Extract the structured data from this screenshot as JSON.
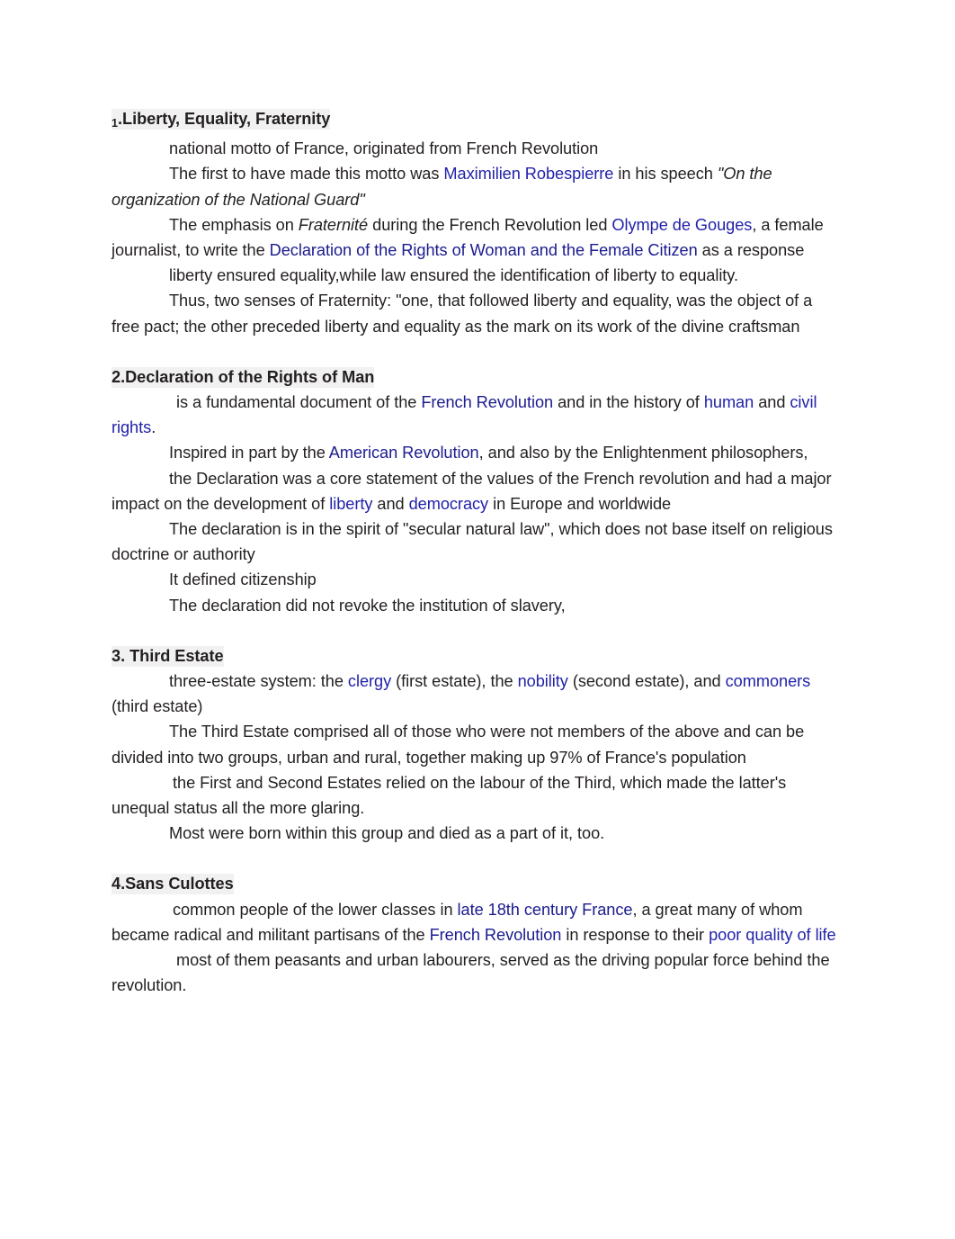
{
  "document": {
    "title": "French Revolution Study Notes",
    "text_color": "#231f20",
    "link_color": "#2222aa",
    "link_color_dark": "#1b1b8f",
    "heading_highlight": "#f1f1f1",
    "page_background": "#ffffff"
  },
  "sections": [
    {
      "number": "1",
      "number_style": "subscript",
      "heading_rest": ".Liberty, Equality, Fraternity",
      "paragraphs": [
        {
          "runs": [
            {
              "t": "national motto of France, originated from French Revolution",
              "s": "plain"
            }
          ]
        },
        {
          "runs": [
            {
              "t": "The first to have made this motto was ",
              "s": "plain"
            },
            {
              "t": "Maximilien Robespierre",
              "s": "link"
            },
            {
              "t": " in his speech ",
              "s": "plain"
            },
            {
              "t": "\"On the organization of the National Guard\"",
              "s": "italic"
            }
          ]
        },
        {
          "runs": [
            {
              "t": "The emphasis on ",
              "s": "plain"
            },
            {
              "t": "Fraternité",
              "s": "italic"
            },
            {
              "t": " during the French Revolution led ",
              "s": "plain"
            },
            {
              "t": "Olympe de Gouges",
              "s": "link"
            },
            {
              "t": ", a female journalist, to write the ",
              "s": "plain"
            },
            {
              "t": "Declaration of the Rights of Woman and the Female Citizen",
              "s": "link-dark"
            },
            {
              "t": " as a response",
              "s": "plain"
            }
          ]
        },
        {
          "runs": [
            {
              "t": "liberty ensured equality,while law ensured the identification of liberty to equality.",
              "s": "plain"
            }
          ]
        },
        {
          "runs": [
            {
              "t": "Thus, two senses of Fraternity: \"one, that followed liberty and equality, was the object of a free pact; the other preceded liberty and equality as the mark on its work of the divine craftsman",
              "s": "plain"
            }
          ]
        }
      ]
    },
    {
      "number": "2",
      "number_style": "normal",
      "heading_rest": "2.Declaration of the Rights of Man",
      "paragraphs": [
        {
          "runs": [
            {
              "t": " is a fundamental document of the ",
              "s": "plain"
            },
            {
              "t": "French Revolution",
              "s": "link-dark"
            },
            {
              "t": " and in the history of ",
              "s": "plain"
            },
            {
              "t": "human",
              "s": "link"
            },
            {
              "t": " and ",
              "s": "plain"
            },
            {
              "t": "civil rights",
              "s": "link"
            },
            {
              "t": ".",
              "s": "plain"
            }
          ]
        },
        {
          "runs": [
            {
              "t": "Inspired in part by the ",
              "s": "plain"
            },
            {
              "t": "American Revolution",
              "s": "link-dark"
            },
            {
              "t": ", and also by the Enlightenment philosophers,",
              "s": "plain"
            }
          ]
        },
        {
          "runs": [
            {
              "t": "the Declaration was a core statement of the values of the French revolution and had a major impact on the development of ",
              "s": "plain"
            },
            {
              "t": "liberty",
              "s": "link"
            },
            {
              "t": " and ",
              "s": "plain"
            },
            {
              "t": "democracy",
              "s": "link"
            },
            {
              "t": " in Europe and worldwide",
              "s": "plain"
            }
          ]
        },
        {
          "runs": [
            {
              "t": "The declaration is in the spirit of \"secular natural law\", which does not base itself on religious doctrine or authority",
              "s": "plain"
            }
          ]
        },
        {
          "runs": [
            {
              "t": "It defined citizenship",
              "s": "plain"
            }
          ]
        },
        {
          "runs": [
            {
              "t": "The declaration did not revoke the institution of slavery,",
              "s": "plain"
            }
          ]
        }
      ]
    },
    {
      "number": "3",
      "number_style": "normal",
      "heading_rest": "3. Third Estate",
      "paragraphs": [
        {
          "runs": [
            {
              "t": "three-estate system: the ",
              "s": "plain"
            },
            {
              "t": "clergy",
              "s": "link"
            },
            {
              "t": " (first estate), the ",
              "s": "plain"
            },
            {
              "t": "nobility",
              "s": "link"
            },
            {
              "t": " (second estate), and ",
              "s": "plain"
            },
            {
              "t": "commoners",
              "s": "link"
            },
            {
              "t": " (third estate)",
              "s": "plain"
            }
          ]
        },
        {
          "runs": [
            {
              "t": "The Third Estate comprised all of those who were not members of the above and can be divided into two groups, urban and rural, together making up 97% of France's population",
              "s": "plain"
            }
          ]
        },
        {
          "runs": [
            {
              "t": "the First and Second Estates relied on the labour of the Third, which made the latter's unequal status all the more glaring.",
              "s": "plain"
            }
          ]
        },
        {
          "runs": [
            {
              "t": "Most were born within this group and died as a part of it, too.",
              "s": "plain"
            }
          ]
        }
      ]
    },
    {
      "number": "4",
      "number_style": "normal",
      "heading_rest": "4.Sans Culottes",
      "paragraphs": [
        {
          "runs": [
            {
              "t": " common people of the lower classes in ",
              "s": "plain"
            },
            {
              "t": "late 18th century France",
              "s": "link-dark"
            },
            {
              "t": ", a great many of whom became radical and militant partisans of the ",
              "s": "plain"
            },
            {
              "t": "French Revolution",
              "s": "link-dark"
            },
            {
              "t": " in response to their ",
              "s": "plain"
            },
            {
              "t": "poor quality of life",
              "s": "link"
            }
          ]
        },
        {
          "runs": [
            {
              "t": " most of them peasants and urban labourers, served as the driving popular force behind the revolution.",
              "s": "plain"
            }
          ]
        }
      ]
    }
  ]
}
